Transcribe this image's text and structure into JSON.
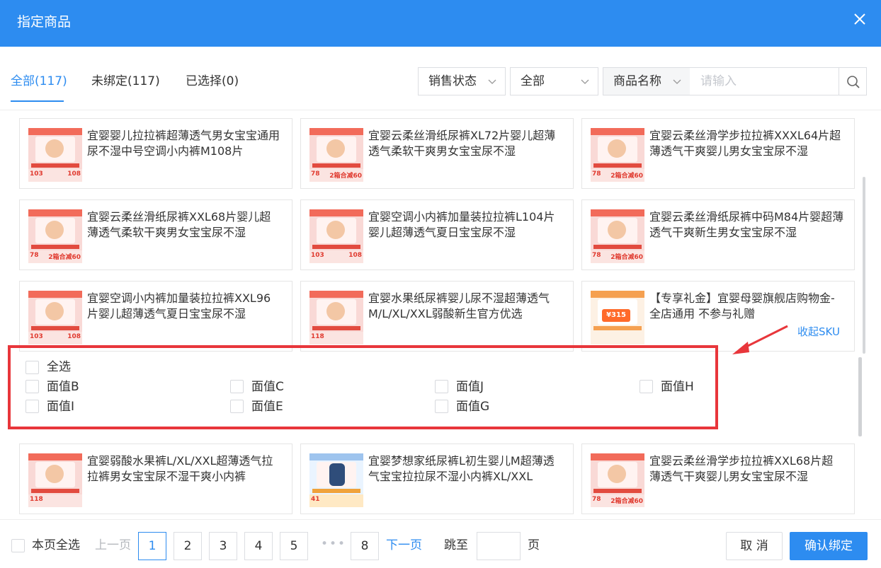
{
  "header": {
    "title": "指定商品",
    "close_icon": "close-icon"
  },
  "tabs": [
    {
      "label": "全部(117)",
      "active": true
    },
    {
      "label": "未绑定(117)",
      "active": false
    },
    {
      "label": "已选择(0)",
      "active": false
    }
  ],
  "filters": {
    "sale_status": "销售状态",
    "status_value": "全部",
    "field": "商品名称",
    "search_placeholder": "请输入"
  },
  "products": [
    {
      "name": "宜婴婴儿拉拉裤超薄透气男女宝宝通用尿不湿中号空调小内裤M108片",
      "price1": "103",
      "price2": "108"
    },
    {
      "name": "宜婴云柔丝滑纸尿裤XL72片婴儿超薄透气柔软干爽男女宝宝尿不湿",
      "price1": "78",
      "price2": "2箱合减60"
    },
    {
      "name": "宜婴云柔丝滑学步拉拉裤XXXL64片超薄透气干爽婴儿男女宝宝尿不湿",
      "price1": "78",
      "price2": "2箱合减60"
    },
    {
      "name": "宜婴云柔丝滑纸尿裤XXL68片婴儿超薄透气柔软干爽男女宝宝尿不湿",
      "price1": "78",
      "price2": "2箱合减60"
    },
    {
      "name": "宜婴空调小内裤加量装拉拉裤L104片婴儿超薄透气夏日宝宝尿不湿",
      "price1": "103",
      "price2": "108"
    },
    {
      "name": "宜婴云柔丝滑纸尿裤中码M84片婴超薄透气干爽新生男女宝宝尿不湿",
      "price1": "78",
      "price2": "2箱合减60"
    },
    {
      "name": "宜婴空调小内裤加量装拉拉裤XXL96片婴儿超薄透气夏日宝宝尿不湿",
      "price1": "103",
      "price2": "108"
    },
    {
      "name": "宜婴水果纸尿裤婴儿尿不湿超薄透气M/L/XL/XXL弱酸新生官方优选",
      "price1": "118",
      "price2": ""
    },
    {
      "name": "【专享礼金】宜婴母婴旗舰店购物金-全店通用 不参与礼赠",
      "price1": "¥315",
      "price2": ""
    },
    {
      "name": "宜婴弱酸水果裤L/XL/XXL超薄透气拉拉裤男女宝宝尿不湿干爽小内裤",
      "price1": "118",
      "price2": ""
    },
    {
      "name": "宜婴梦想家纸尿裤L初生婴儿M超薄透气宝宝拉拉尿不湿小内裤XL/XXL",
      "price1": "41",
      "price2": ""
    },
    {
      "name": "宜婴云柔丝滑学步拉拉裤XXL68片超薄透气干爽婴儿男女宝宝尿不湿",
      "price1": "78",
      "price2": "2箱合减60"
    }
  ],
  "collapse_sku": "收起SKU",
  "sku": {
    "select_all": "全选",
    "options": [
      "面值B",
      "面值C",
      "面值J",
      "面值H",
      "面值I",
      "面值E",
      "面值G"
    ]
  },
  "footer": {
    "page_select_all": "本页全选",
    "prev": "上一页",
    "pages": [
      "1",
      "2",
      "3",
      "4",
      "5",
      "8"
    ],
    "ellipsis": "•••",
    "next": "下一页",
    "jump_label": "跳至",
    "page_unit": "页",
    "cancel": "取 消",
    "confirm": "确认绑定"
  },
  "colors": {
    "primary": "#2d8cf0",
    "annotation": "#e8363b"
  }
}
